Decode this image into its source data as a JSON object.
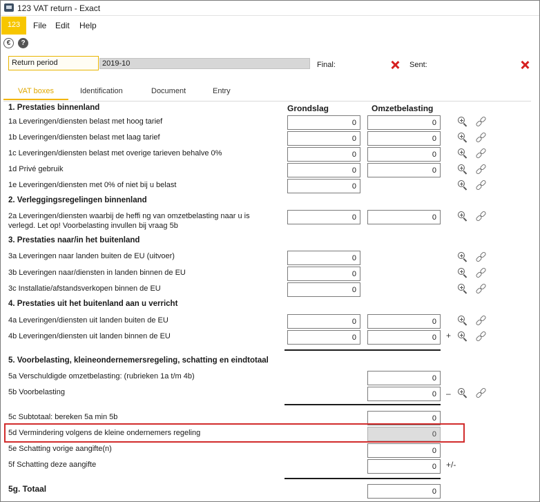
{
  "window": {
    "title": "123 VAT return - Exact"
  },
  "menu": {
    "logo": "123",
    "file": "File",
    "edit": "Edit",
    "help": "Help"
  },
  "toolbar": {
    "euro_glyph": "€",
    "help_glyph": "?"
  },
  "header": {
    "return_period_label": "Return period",
    "return_period_value": "2019-10",
    "final_label": "Final:",
    "sent_label": "Sent:"
  },
  "tabs": {
    "vat_boxes": "VAT boxes",
    "identification": "Identification",
    "document": "Document",
    "entry": "Entry"
  },
  "columns": {
    "grondslag": "Grondslag",
    "omzetbelasting": "Omzetbelasting"
  },
  "sections": {
    "s1": "1. Prestaties binnenland",
    "s2": "2. Verleggingsregelingen binnenland",
    "s3": "3. Prestaties naar/in het buitenland",
    "s4": "4. Prestaties uit het buitenland aan u verricht",
    "s5": "5. Voorbelasting, kleineondernemersregeling, schatting en eindtotaal"
  },
  "rows": {
    "r1a": {
      "label": "1a Leveringen/diensten belast met hoog tarief",
      "grondslag": "0",
      "omzet": "0"
    },
    "r1b": {
      "label": "1b Leveringen/diensten belast met laag tarief",
      "grondslag": "0",
      "omzet": "0"
    },
    "r1c": {
      "label": "1c Leveringen/diensten belast met overige tarieven behalve 0%",
      "grondslag": "0",
      "omzet": "0"
    },
    "r1d": {
      "label": "1d Privé gebruik",
      "grondslag": "0",
      "omzet": "0"
    },
    "r1e": {
      "label": "1e Leveringen/diensten met 0% of niet bij u belast",
      "grondslag": "0"
    },
    "r2a": {
      "label_line1": "2a Leveringen/diensten waarbij de heffi ng van omzetbelasting naar u is",
      "label_line2": "verlegd. Let op! Voorbelasting invullen bij vraag 5b",
      "grondslag": "0",
      "omzet": "0"
    },
    "r3a": {
      "label": "3a Leveringen naar landen buiten de EU (uitvoer)",
      "grondslag": "0"
    },
    "r3b": {
      "label": "3b Leveringen naar/diensten in landen binnen de EU",
      "grondslag": "0"
    },
    "r3c": {
      "label": "3c Installatie/afstandsverkopen binnen de EU",
      "grondslag": "0"
    },
    "r4a": {
      "label": "4a Leveringen/diensten uit landen buiten de EU",
      "grondslag": "0",
      "omzet": "0"
    },
    "r4b": {
      "label": "4b Leveringen/diensten uit landen binnen de EU",
      "grondslag": "0",
      "omzet": "0"
    },
    "r5a": {
      "label": "5a Verschuldigde omzetbelasting: (rubrieken 1a t/m 4b)",
      "omzet": "0"
    },
    "r5b": {
      "label": "5b Voorbelasting",
      "omzet": "0"
    },
    "r5c": {
      "label": "5c Subtotaal: bereken 5a min 5b",
      "omzet": "0"
    },
    "r5d": {
      "label": "5d Vermindering volgens de kleine ondernemers regeling",
      "omzet": "0"
    },
    "r5e": {
      "label": "5e Schatting vorige aangifte(n)",
      "omzet": "0"
    },
    "r5f": {
      "label": "5f  Schatting deze aangifte",
      "omzet": "0"
    },
    "r5g": {
      "label": "5g. Totaal",
      "omzet": "0"
    }
  },
  "operators": {
    "plus": "+",
    "minus": "–",
    "plus_minus": "+/-"
  },
  "colors": {
    "accent": "#f7c600",
    "delete_red": "#d62020",
    "highlight_border": "#d12b2b"
  }
}
